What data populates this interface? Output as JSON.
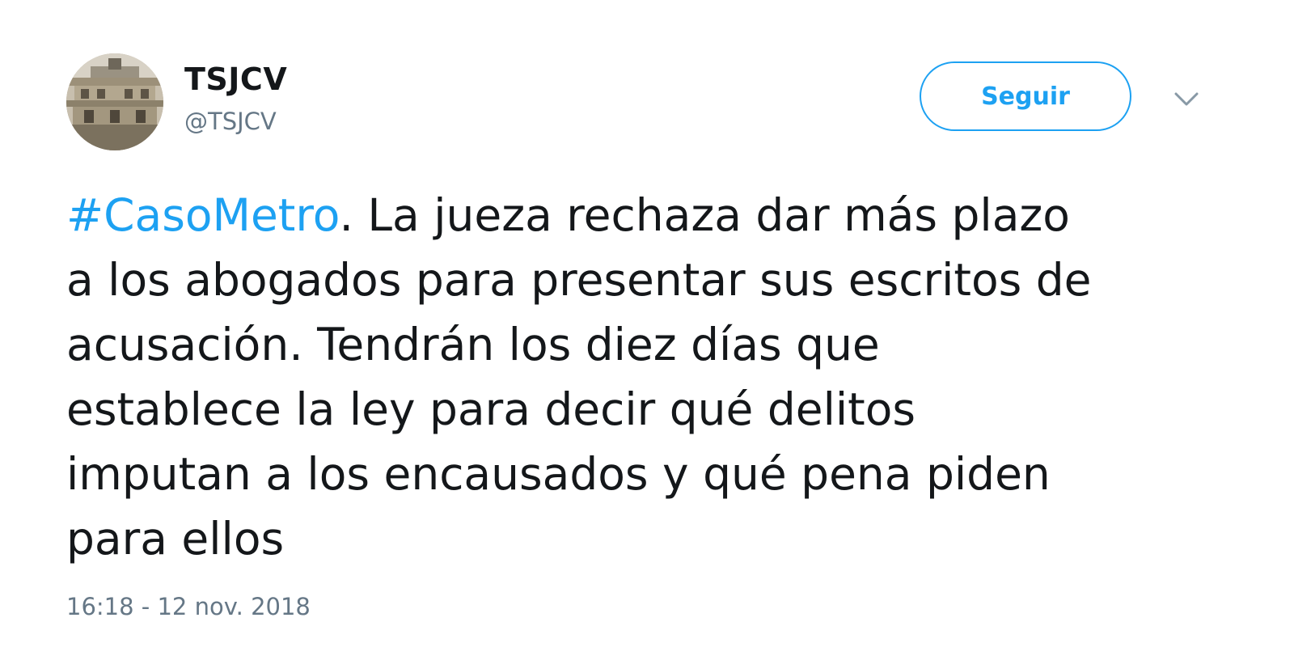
{
  "account": {
    "display_name": "TSJCV",
    "handle": "@TSJCV"
  },
  "actions": {
    "follow_label": "Seguir",
    "more_icon": "chevron-down-icon"
  },
  "tweet": {
    "hashtag": "#CasoMetro",
    "line_1_rest": ". La jueza rechaza dar más plazo",
    "line_2": "a los abogados para presentar sus escritos de",
    "line_3": "acusación. Tendrán los diez días que",
    "line_4": "establece la ley para decir qué delitos",
    "line_5": "imputan a los encausados y qué pena piden",
    "line_6": "para ellos",
    "timestamp": "16:18 - 12 nov. 2018"
  },
  "colors": {
    "accent": "#1da1f2",
    "text": "#14171a",
    "secondary": "#657786"
  }
}
